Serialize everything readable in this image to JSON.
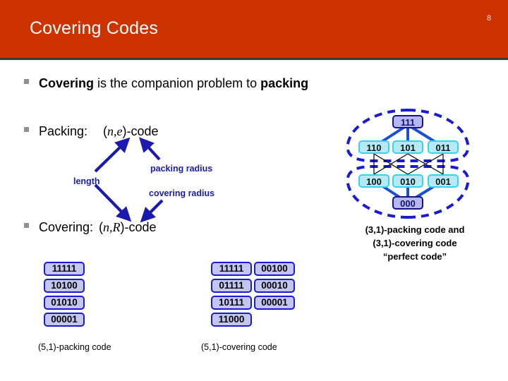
{
  "header": {
    "title": "Covering Codes",
    "page_number": "8",
    "band_color": "#cc3300",
    "title_color": "#ffffff"
  },
  "bullets": {
    "covering_companion": {
      "part1": "Covering",
      "part2": " is the companion problem to ",
      "part3": "packing"
    },
    "packing": {
      "label": "Packing:",
      "code_open": "(",
      "code_n": "n",
      "code_comma": ",",
      "code_e": "e",
      "code_close": ")-code"
    },
    "covering": {
      "label": "Covering:",
      "code_open": "(",
      "code_n": "n",
      "code_comma": ",",
      "code_R": "R",
      "code_close": ")-code"
    }
  },
  "annotations": {
    "length": "length",
    "packing_radius": "packing radius",
    "covering_radius": "covering radius",
    "color": "#1a1ab0"
  },
  "cube_diagram": {
    "top_node": "111",
    "bottom_node": "000",
    "upper_layer": [
      "110",
      "101",
      "011"
    ],
    "lower_layer": [
      "100",
      "010",
      "001"
    ],
    "node_mid_fill": "#b9e8f5",
    "node_mid_border": "#35d3ee",
    "node_corner_fill": "#b5b8ee",
    "node_corner_border": "#14148c",
    "ball_outline_color": "#1a1ad2",
    "edge_color": "#1a4fd6"
  },
  "perfect_code_caption": {
    "line1": "(3,1)-packing code and",
    "line2": "(3,1)-covering code",
    "line3": "“perfect code”"
  },
  "packing_code_table": {
    "caption": "(5,1)-packing code",
    "columns": [
      [
        "11111",
        "10100",
        "01010",
        "00001"
      ]
    ]
  },
  "covering_code_table": {
    "caption": "(5,1)-covering code",
    "columns": [
      [
        "11111",
        "01111",
        "10111",
        "11000"
      ],
      [
        "00100",
        "00010",
        "00001"
      ]
    ]
  },
  "chip_style": {
    "fill": "#c3c6f0",
    "border": "#1a1ad2"
  }
}
